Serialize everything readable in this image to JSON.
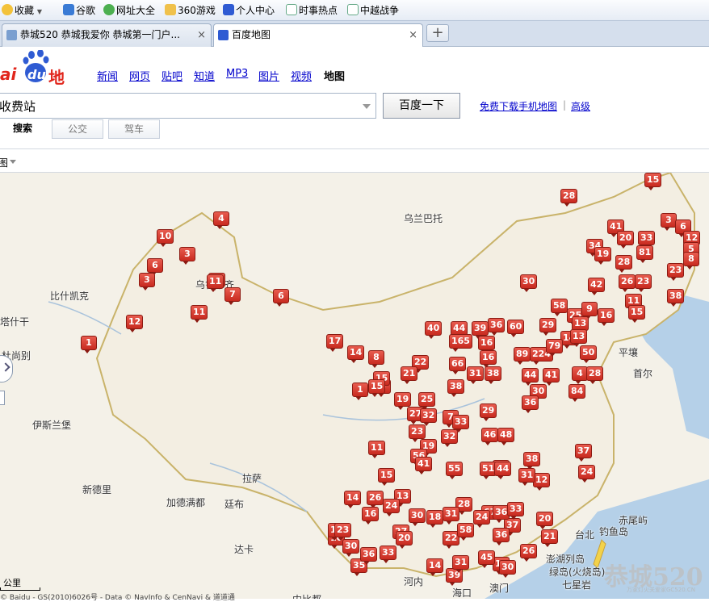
{
  "favorites": [
    {
      "label": "收藏",
      "icon": "star-icon"
    },
    {
      "label": "谷歌",
      "icon": "google-icon"
    },
    {
      "label": "网址大全",
      "icon": "globe-icon"
    },
    {
      "label": "360游戏",
      "icon": "folder-icon"
    },
    {
      "label": "个人中心",
      "icon": "paw-icon"
    },
    {
      "label": "时事热点",
      "icon": "page-icon"
    },
    {
      "label": "中越战争",
      "icon": "page-icon"
    }
  ],
  "tabs": [
    {
      "label": "恭城520 恭城我爱你 恭城第一门户...",
      "active": false,
      "close": "×"
    },
    {
      "label": "百度地图",
      "active": true,
      "close": "×"
    }
  ],
  "new_tab_label": "+",
  "logo": {
    "text_prefix": "ai",
    "text_du": "du",
    "text_map": "地图"
  },
  "nav": [
    {
      "label": "新闻"
    },
    {
      "label": "网页"
    },
    {
      "label": "贴吧"
    },
    {
      "label": "知道"
    },
    {
      "label": "MP3"
    },
    {
      "label": "图片"
    },
    {
      "label": "视频"
    }
  ],
  "nav_current": "地图",
  "search": {
    "value": "收费站",
    "button": "百度一下"
  },
  "links": {
    "download": "免费下载手机地图",
    "separator": "|",
    "advanced": "高级"
  },
  "search_tabs": {
    "search": "搜索",
    "bus": "公交",
    "drive": "驾车"
  },
  "map_control_label": "图",
  "scale_label": "公里",
  "copyright": "© Baidu - GS(2010)6026号 - Data © NavInfo & CenNavi & 道道通",
  "watermark": "恭城520",
  "watermark_sub": "万家灯火关爱家GC520.CN",
  "colors": {
    "marker": "#d23a2e",
    "link": "#0000cc",
    "border_line": "#c9b36a",
    "land": "#f4f1e8"
  },
  "cities": [
    {
      "name": "乌兰巴托"
    },
    {
      "name": "比什凯克"
    },
    {
      "name": "杜尚别"
    },
    {
      "name": "伊斯兰堡"
    },
    {
      "name": "新德里"
    },
    {
      "name": "加德满都"
    },
    {
      "name": "拉萨"
    },
    {
      "name": "廷布"
    },
    {
      "name": "达卡"
    },
    {
      "name": "河内"
    },
    {
      "name": "海口"
    },
    {
      "name": "澳门"
    },
    {
      "name": "台北"
    },
    {
      "name": "平壤"
    },
    {
      "name": "首尔"
    },
    {
      "name": "赤尾屿"
    },
    {
      "name": "钓鱼岛"
    },
    {
      "name": "澎湖列岛"
    },
    {
      "name": "绿岛(火烧岛)"
    },
    {
      "name": "七星岩"
    },
    {
      "name": "乌鲁木齐"
    },
    {
      "name": "塔什干"
    },
    {
      "name": "内比都"
    }
  ],
  "markers": [
    "15",
    "28",
    "4",
    "10",
    "3",
    "6",
    "3",
    "11",
    "11",
    "7",
    "6",
    "11",
    "12",
    "1",
    "41",
    "20",
    "33",
    "3",
    "6",
    "12",
    "34",
    "19",
    "81",
    "5",
    "8",
    "28",
    "23",
    "42",
    "26",
    "23",
    "30",
    "38",
    "58",
    "25",
    "9",
    "16",
    "11",
    "15",
    "17",
    "14",
    "8",
    "40",
    "44",
    "39",
    "36",
    "60",
    "29",
    "13",
    "14",
    "165",
    "16",
    "66",
    "22",
    "89",
    "224",
    "79",
    "16",
    "50",
    "13",
    "21",
    "6",
    "15",
    "31",
    "38",
    "38",
    "44",
    "41",
    "4",
    "28",
    "1",
    "15",
    "19",
    "25",
    "30",
    "84",
    "27",
    "32",
    "7",
    "33",
    "29",
    "36",
    "46",
    "48",
    "11",
    "32",
    "23",
    "19",
    "56",
    "41",
    "38",
    "31",
    "12",
    "55",
    "51",
    "44",
    "31",
    "37",
    "24",
    "15",
    "14",
    "26",
    "13",
    "16",
    "24",
    "30",
    "18",
    "27",
    "37",
    "20",
    "67",
    "28",
    "31",
    "24",
    "36",
    "33",
    "22",
    "58",
    "36",
    "10",
    "30",
    "33",
    "26",
    "39",
    "15",
    "30",
    "21",
    "14",
    "31",
    "45",
    "35",
    "36",
    "20",
    "10",
    "23"
  ]
}
